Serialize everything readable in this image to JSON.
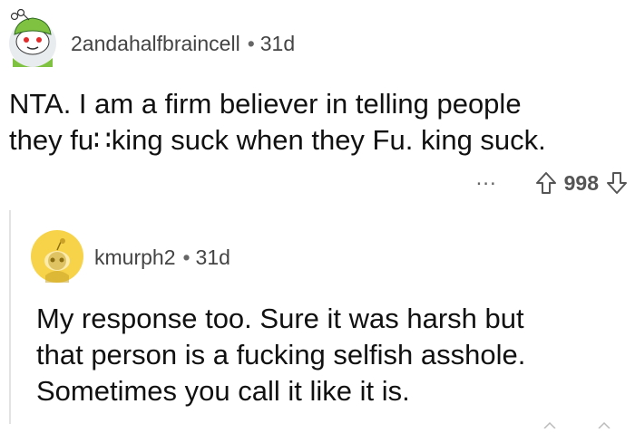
{
  "comment": {
    "username": "2andahalfbraincell",
    "separator": "•",
    "age": "31d",
    "lines": [
      "NTA. I am a firm believer in telling people",
      "they fu∷king suck when they Fu. king suck."
    ],
    "more_label": "...",
    "score": "998"
  },
  "reply": {
    "username": "kmurph2",
    "separator": "•",
    "age": "31d",
    "lines": [
      "My response too. Sure it was harsh but",
      "that person is a fucking selfish asshole.",
      "Sometimes you call it like it is."
    ]
  },
  "icons": {
    "avatar_main": "snoo-green-avatar-icon",
    "avatar_reply": "snoo-default-avatar-icon",
    "upvote": "arrow-up-icon",
    "downvote": "arrow-down-icon",
    "more": "more-icon"
  },
  "colors": {
    "avatar_main_bg": "#e8ecef",
    "avatar_reply_bg": "#f7d34a",
    "text": "#111111",
    "meta": "#444444"
  }
}
